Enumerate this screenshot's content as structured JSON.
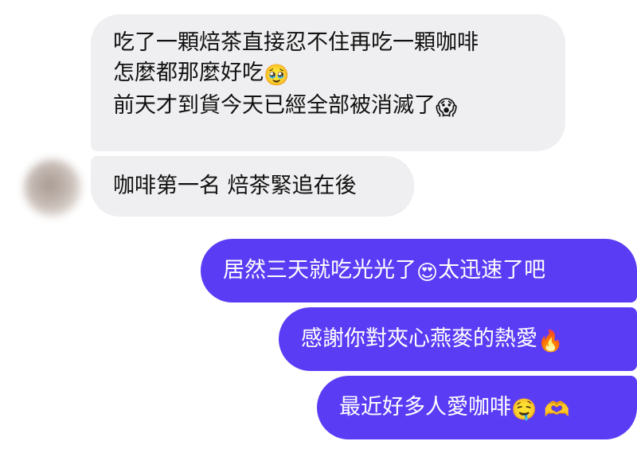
{
  "messages": [
    {
      "lines": [
        "吃了一顆焙茶直接忍不住再吃一顆咖啡",
        "怎麼都那麼好吃",
        "前天才到貨今天已經全部被消滅了"
      ],
      "emoji": [
        "",
        "🥹",
        "😱"
      ]
    },
    {
      "text": "咖啡第一名 焙茶緊追在後"
    },
    {
      "text": "居然三天就吃光光了",
      "emoji": "😍",
      "text_after": "太迅速了吧"
    },
    {
      "text": "感謝你對夾心燕麥的熱愛",
      "emoji": "🔥"
    },
    {
      "text": "最近好多人愛咖啡",
      "emoji": [
        "🤤",
        "🫶"
      ]
    }
  ],
  "colors": {
    "incoming_bubble": "#efeff1",
    "outgoing_bubble": "#5b3cf5"
  },
  "icons": {
    "avatar": "blurred-contact-avatar"
  }
}
